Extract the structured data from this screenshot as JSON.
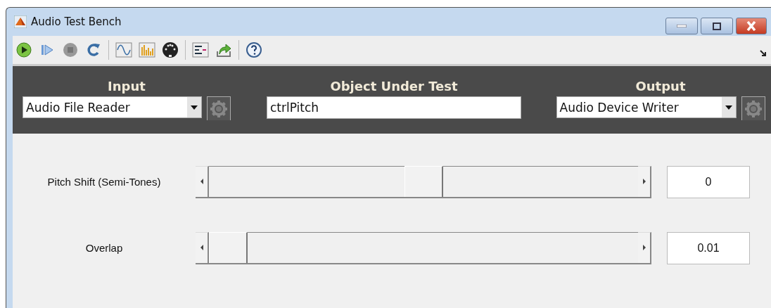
{
  "window": {
    "title": "Audio Test Bench"
  },
  "header": [
    {
      "kind": "dropdown",
      "label": "Input",
      "value": "Audio File Reader"
    },
    {
      "kind": "text",
      "label": "Object Under Test",
      "value": "ctrlPitch"
    },
    {
      "kind": "dropdown",
      "label": "Output",
      "value": "Audio Device Writer"
    }
  ],
  "parameters": [
    {
      "name": "Pitch Shift (Semi-Tones)",
      "level": 0.5,
      "value": "0"
    },
    {
      "name": "Overlap",
      "level": 0,
      "value": "0.01"
    }
  ]
}
